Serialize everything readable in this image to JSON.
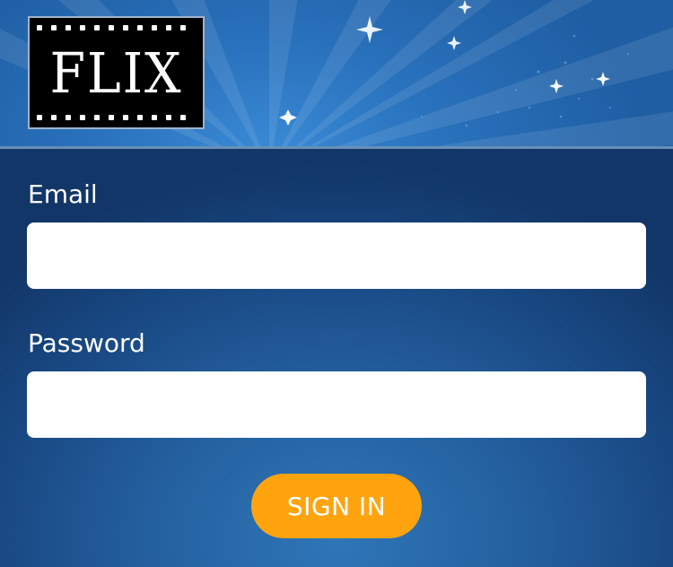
{
  "app": {
    "logo_text": "FLIX",
    "colors": {
      "background": "#1d528f",
      "header": "#2a72bd",
      "button": "#ffa40f",
      "input": "#ffffff"
    }
  },
  "form": {
    "email_label": "Email",
    "email_value": "",
    "password_label": "Password",
    "password_value": "",
    "signin_label": "SIGN IN"
  }
}
